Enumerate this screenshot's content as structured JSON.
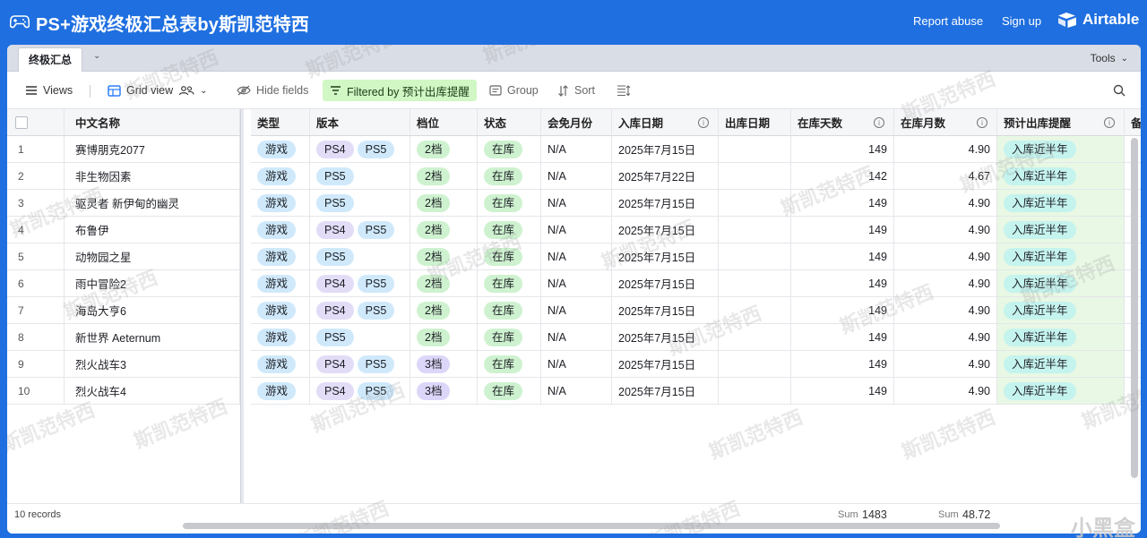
{
  "app": {
    "title": "PS+游戏终极汇总表by斯凯范特西",
    "report_abuse": "Report abuse",
    "sign_up": "Sign up",
    "brand": "Airtable"
  },
  "tabs": {
    "active": "终极汇总",
    "tools": "Tools"
  },
  "toolbar": {
    "views": "Views",
    "grid_view": "Grid view",
    "hide_fields": "Hide fields",
    "filter": "Filtered by 预计出库提醒",
    "group": "Group",
    "sort": "Sort"
  },
  "columns": {
    "name": "中文名称",
    "type": "类型",
    "version": "版本",
    "tier": "档位",
    "status": "状态",
    "free_month": "会免月份",
    "in_date": "入库日期",
    "out_date": "出库日期",
    "days": "在库天数",
    "months": "在库月数",
    "remind": "预计出库提醒",
    "note": "备"
  },
  "rows": [
    {
      "n": "1",
      "name": "赛博朋克2077",
      "type": "游戏",
      "v": [
        "PS4",
        "PS5"
      ],
      "tier": "2档",
      "status": "在库",
      "free": "N/A",
      "in": "2025年7月15日",
      "days": "149",
      "months": "4.90",
      "remind": "入库近半年"
    },
    {
      "n": "2",
      "name": "非生物因素",
      "type": "游戏",
      "v": [
        "PS5"
      ],
      "tier": "2档",
      "status": "在库",
      "free": "N/A",
      "in": "2025年7月22日",
      "days": "142",
      "months": "4.67",
      "remind": "入库近半年"
    },
    {
      "n": "3",
      "name": "驱灵者 新伊甸的幽灵",
      "type": "游戏",
      "v": [
        "PS5"
      ],
      "tier": "2档",
      "status": "在库",
      "free": "N/A",
      "in": "2025年7月15日",
      "days": "149",
      "months": "4.90",
      "remind": "入库近半年"
    },
    {
      "n": "4",
      "name": "布鲁伊",
      "type": "游戏",
      "v": [
        "PS4",
        "PS5"
      ],
      "tier": "2档",
      "status": "在库",
      "free": "N/A",
      "in": "2025年7月15日",
      "days": "149",
      "months": "4.90",
      "remind": "入库近半年"
    },
    {
      "n": "5",
      "name": "动物园之星",
      "type": "游戏",
      "v": [
        "PS5"
      ],
      "tier": "2档",
      "status": "在库",
      "free": "N/A",
      "in": "2025年7月15日",
      "days": "149",
      "months": "4.90",
      "remind": "入库近半年"
    },
    {
      "n": "6",
      "name": "雨中冒险2",
      "type": "游戏",
      "v": [
        "PS4",
        "PS5"
      ],
      "tier": "2档",
      "status": "在库",
      "free": "N/A",
      "in": "2025年7月15日",
      "days": "149",
      "months": "4.90",
      "remind": "入库近半年"
    },
    {
      "n": "7",
      "name": "海岛大亨6",
      "type": "游戏",
      "v": [
        "PS4",
        "PS5"
      ],
      "tier": "2档",
      "status": "在库",
      "free": "N/A",
      "in": "2025年7月15日",
      "days": "149",
      "months": "4.90",
      "remind": "入库近半年"
    },
    {
      "n": "8",
      "name": "新世界 Aeternum",
      "type": "游戏",
      "v": [
        "PS5"
      ],
      "tier": "2档",
      "status": "在库",
      "free": "N/A",
      "in": "2025年7月15日",
      "days": "149",
      "months": "4.90",
      "remind": "入库近半年"
    },
    {
      "n": "9",
      "name": "烈火战车3",
      "type": "游戏",
      "v": [
        "PS4",
        "PS5"
      ],
      "tier": "3档",
      "status": "在库",
      "free": "N/A",
      "in": "2025年7月15日",
      "days": "149",
      "months": "4.90",
      "remind": "入库近半年"
    },
    {
      "n": "10",
      "name": "烈火战车4",
      "type": "游戏",
      "v": [
        "PS4",
        "PS5"
      ],
      "tier": "3档",
      "status": "在库",
      "free": "N/A",
      "in": "2025年7月15日",
      "days": "149",
      "months": "4.90",
      "remind": "入库近半年"
    }
  ],
  "footer": {
    "records": "10 records",
    "sum_label": "Sum",
    "sum_days": "1483",
    "sum_months": "48.72"
  },
  "watermark": "斯凯范特西",
  "corner_logo": "小黑盒"
}
